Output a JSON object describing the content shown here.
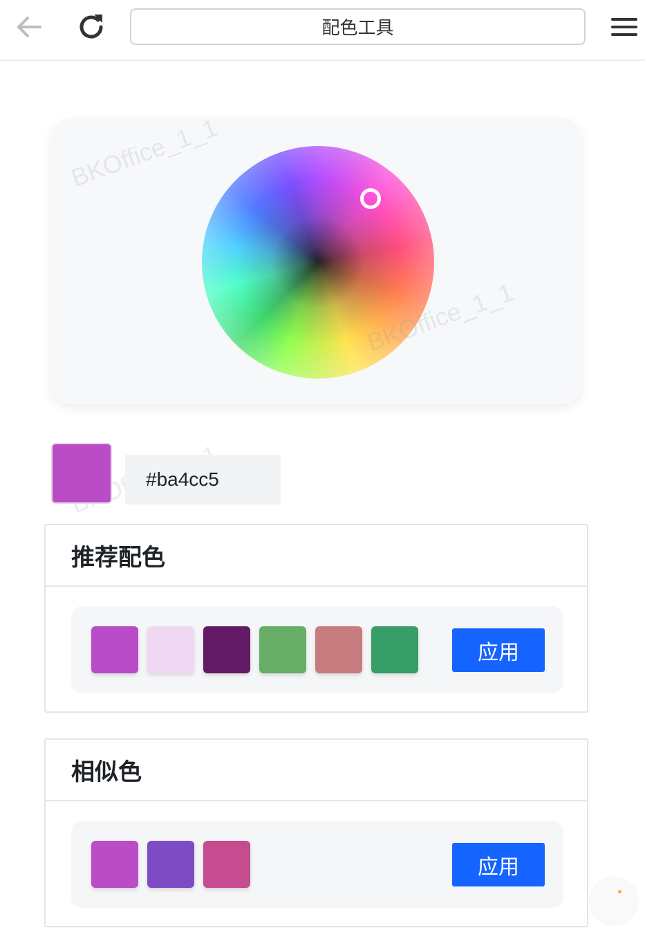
{
  "topbar": {
    "back_icon": "arrow-left-icon",
    "reload_icon": "reload-icon",
    "url_title": "配色工具",
    "menu_icon": "hamburger-menu-icon"
  },
  "picker": {
    "handle_color": "#ffffff",
    "current_color": "#ba4cc5",
    "hex_value": "#ba4cc5"
  },
  "watermark": "BKOffice_1_1",
  "recommended": {
    "title": "推荐配色",
    "colors": [
      "#b84cc6",
      "#f0d8f2",
      "#611a63",
      "#67ad67",
      "#c77c80",
      "#369e66"
    ],
    "apply_label": "应用"
  },
  "similar": {
    "title": "相似色",
    "colors": [
      "#ba4cc5",
      "#7d4cc5",
      "#c54c8e"
    ],
    "apply_label": "应用"
  },
  "colors": {
    "accent": "#1664ff"
  }
}
